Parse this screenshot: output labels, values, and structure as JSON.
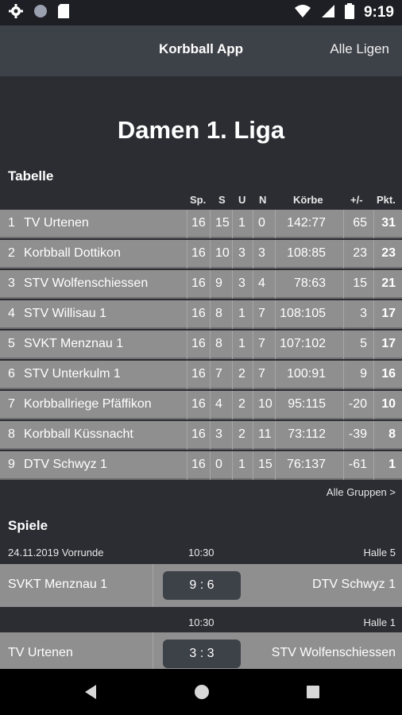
{
  "status_bar": {
    "time": "9:19",
    "icons": [
      "settings-icon",
      "circle-icon",
      "sd-card-icon",
      "wifi-icon",
      "signal-icon",
      "battery-icon"
    ]
  },
  "app_bar": {
    "title": "Korbball App",
    "action": "Alle Ligen"
  },
  "league_title": "Damen 1. Liga",
  "table": {
    "section_title": "Tabelle",
    "headers": {
      "played": "Sp.",
      "won": "S",
      "draw": "U",
      "lost": "N",
      "baskets": "Körbe",
      "diff": "+/-",
      "points": "Pkt."
    },
    "rows": [
      {
        "rank": "1",
        "team": "TV Urtenen",
        "played": "16",
        "won": "15",
        "draw": "1",
        "lost": "0",
        "baskets": "142:77",
        "diff": "65",
        "points": "31"
      },
      {
        "rank": "2",
        "team": "Korbball Dottikon",
        "played": "16",
        "won": "10",
        "draw": "3",
        "lost": "3",
        "baskets": "108:85",
        "diff": "23",
        "points": "23"
      },
      {
        "rank": "3",
        "team": "STV Wolfenschiessen",
        "played": "16",
        "won": "9",
        "draw": "3",
        "lost": "4",
        "baskets": "78:63",
        "diff": "15",
        "points": "21"
      },
      {
        "rank": "4",
        "team": "STV Willisau 1",
        "played": "16",
        "won": "8",
        "draw": "1",
        "lost": "7",
        "baskets": "108:105",
        "diff": "3",
        "points": "17"
      },
      {
        "rank": "5",
        "team": "SVKT Menznau 1",
        "played": "16",
        "won": "8",
        "draw": "1",
        "lost": "7",
        "baskets": "107:102",
        "diff": "5",
        "points": "17"
      },
      {
        "rank": "6",
        "team": "STV Unterkulm 1",
        "played": "16",
        "won": "7",
        "draw": "2",
        "lost": "7",
        "baskets": "100:91",
        "diff": "9",
        "points": "16"
      },
      {
        "rank": "7",
        "team": "Korbballriege Pfäffikon",
        "played": "16",
        "won": "4",
        "draw": "2",
        "lost": "10",
        "baskets": "95:115",
        "diff": "-20",
        "points": "10"
      },
      {
        "rank": "8",
        "team": "Korbball Küssnacht",
        "played": "16",
        "won": "3",
        "draw": "2",
        "lost": "11",
        "baskets": "73:112",
        "diff": "-39",
        "points": "8"
      },
      {
        "rank": "9",
        "team": "DTV Schwyz 1",
        "played": "16",
        "won": "0",
        "draw": "1",
        "lost": "15",
        "baskets": "76:137",
        "diff": "-61",
        "points": "1"
      }
    ],
    "all_groups_link": "Alle Gruppen >"
  },
  "games": {
    "section_title": "Spiele",
    "matches": [
      {
        "date": "24.11.2019 Vorrunde",
        "time": "10:30",
        "hall": "Halle 5",
        "home": "SVKT Menznau 1",
        "score": "9 : 6",
        "away": "DTV Schwyz 1"
      },
      {
        "date": "",
        "time": "10:30",
        "hall": "Halle 1",
        "home": "TV Urtenen",
        "score": "3 : 3",
        "away": "STV Wolfenschiessen"
      }
    ]
  }
}
